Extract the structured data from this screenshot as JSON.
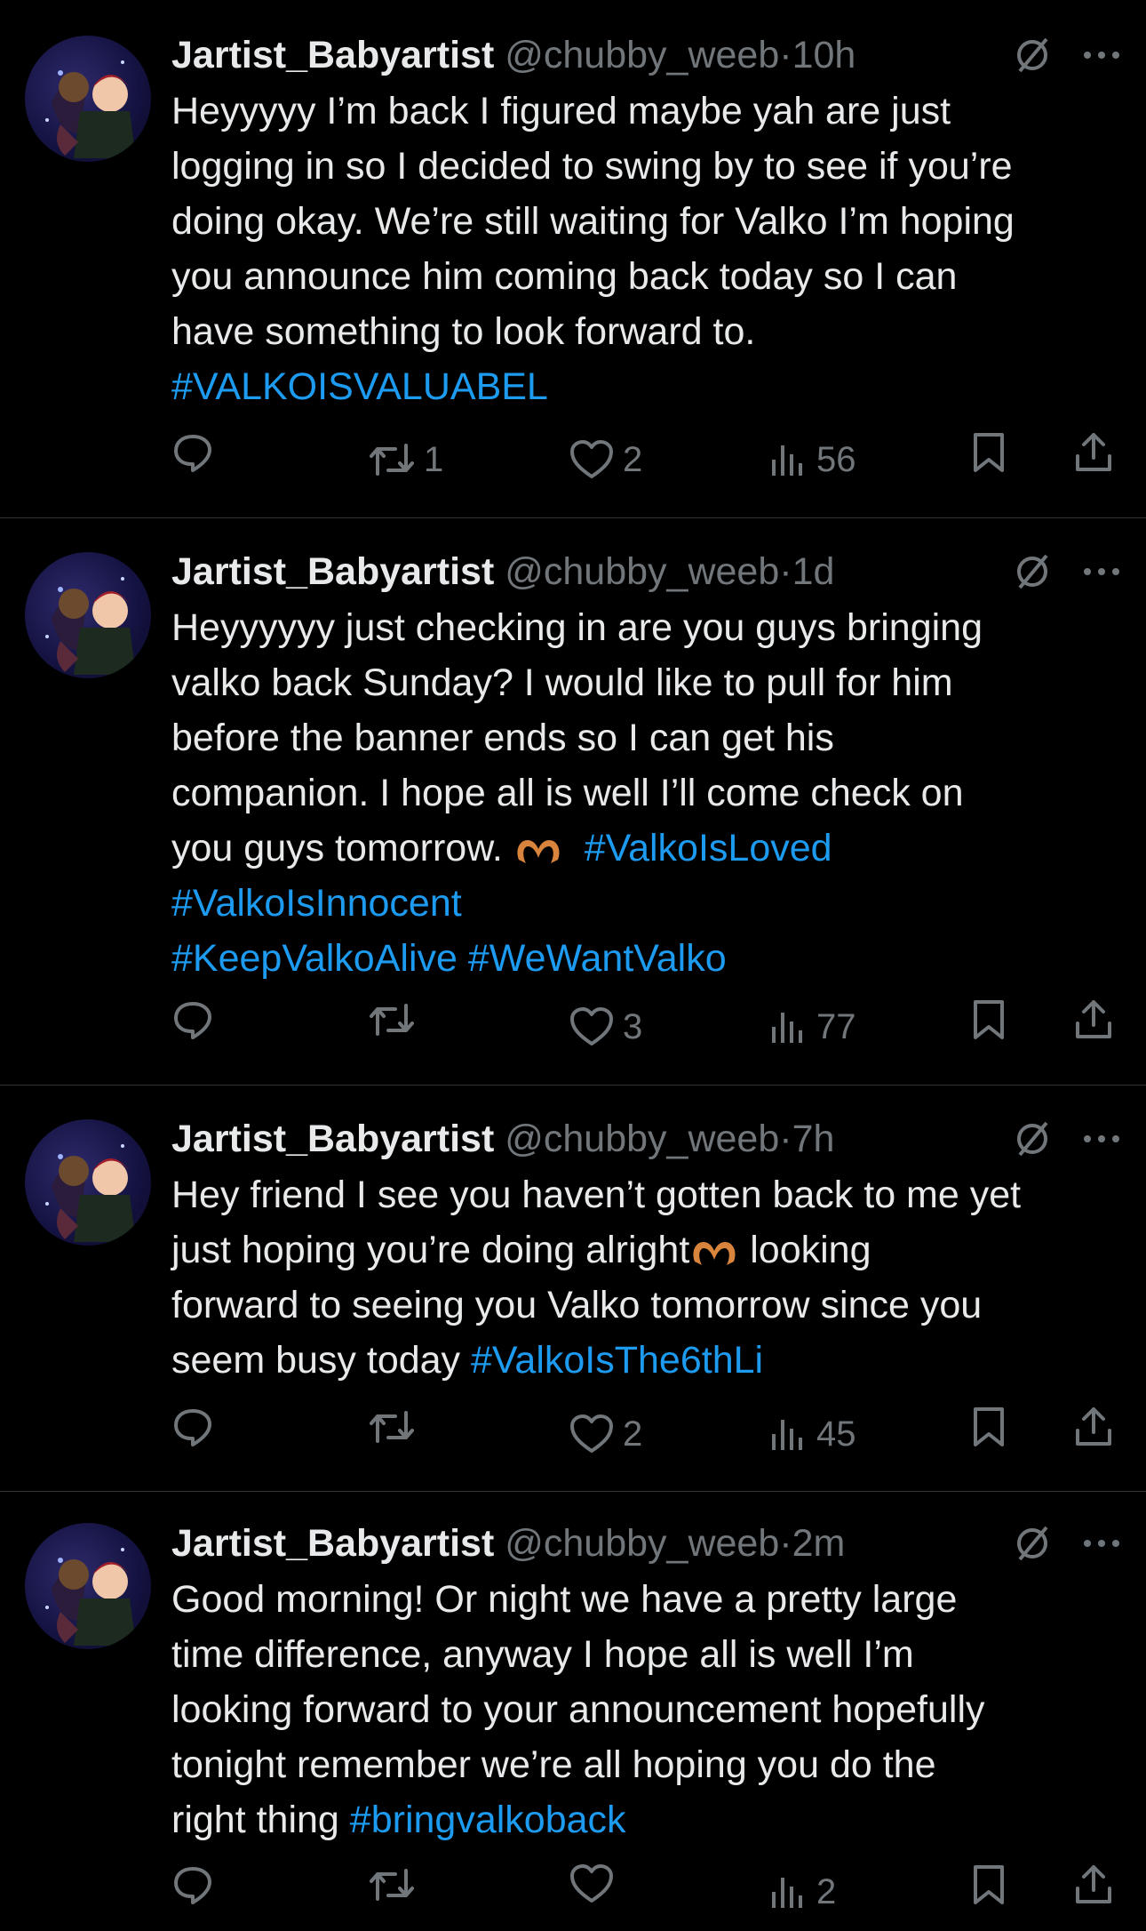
{
  "colors": {
    "background": "#000000",
    "text": "#e7e9ea",
    "muted": "#71767b",
    "link": "#1d9bf0",
    "divider": "#2f3336"
  },
  "tweets": [
    {
      "name": "Jartist_Babyartist",
      "handle": "@chubby_weeb",
      "dot": "·",
      "time": "10h",
      "lines": [
        "Heyyyyy I’m back I figured maybe yah are just",
        "logging in so I decided to swing by to see if you’re",
        "doing okay. We’re still waiting for Valko I’m hoping",
        "you announce him coming back today so I can",
        "have something to look forward to."
      ],
      "hashtags": [
        "#VALKOISVALUABEL"
      ],
      "replies": "",
      "retweets": "1",
      "likes": "2",
      "views": "56"
    },
    {
      "name": "Jartist_Babyartist",
      "handle": "@chubby_weeb",
      "dot": "·",
      "time": "1d",
      "lines": [
        "Heyyyyyy just checking in are you guys bringing",
        "valko back Sunday? I would like to pull for him",
        "before the banner ends so I can get his",
        "companion. I hope all is well I’ll come check on",
        "you guys tomorrow."
      ],
      "emoji": "heart-hands",
      "hashtags": [
        "#ValkoIsLoved",
        "#ValkoIsInnocent",
        "#KeepValkoAlive",
        "#WeWantValko"
      ],
      "replies": "",
      "retweets": "",
      "likes": "3",
      "views": "77"
    },
    {
      "name": "Jartist_Babyartist",
      "handle": "@chubby_weeb",
      "dot": "·",
      "time": "7h",
      "line1": "Hey friend I see you haven’t gotten back to me yet",
      "line2a": "just hoping you’re doing alright",
      "line2b": " looking",
      "line3": "forward to seeing you Valko tomorrow since you",
      "line4": "seem busy today ",
      "hashtag": "#ValkoIsThe6thLi",
      "replies": "",
      "retweets": "",
      "likes": "2",
      "views": "45"
    },
    {
      "name": "Jartist_Babyartist",
      "handle": "@chubby_weeb",
      "dot": "·",
      "time": "2m",
      "lines": [
        "Good morning! Or night we have a pretty large",
        "time difference, anyway I hope all is well I’m",
        "looking forward to your announcement hopefully",
        "tonight remember we’re all hoping you do the"
      ],
      "lastline": "right thing ",
      "hashtag": "#bringvalkoback",
      "replies": "",
      "retweets": "",
      "likes": "",
      "views": "2"
    }
  ]
}
